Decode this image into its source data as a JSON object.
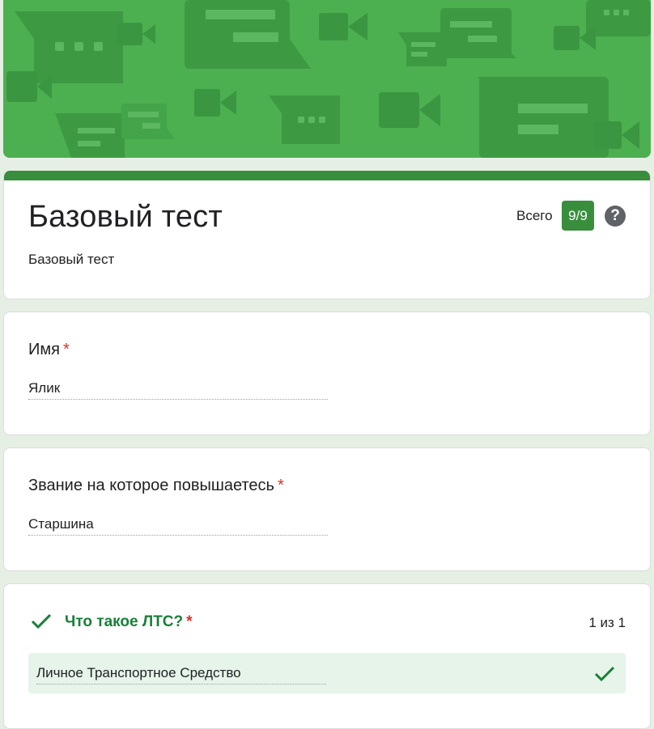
{
  "colors": {
    "accent": "#388e3c",
    "banner": "#4caf50",
    "correct": "#188038",
    "required": "#d93025",
    "correct_bg": "#e6f4ea"
  },
  "header": {
    "title": "Базовый тест",
    "description": "Базовый тест",
    "score_label": "Всего",
    "score_value": "9/9",
    "help_icon_glyph": "?"
  },
  "questions": [
    {
      "title": "Имя",
      "required_mark": "*",
      "answer": "Ялик"
    },
    {
      "title": "Звание на которое повышаетесь",
      "required_mark": "*",
      "answer": "Старшина"
    },
    {
      "title": "Что такое ЛТС?",
      "required_mark": "*",
      "points": "1 из 1",
      "answer": "Личное Транспортное Средство",
      "status_icon": "check-icon"
    }
  ]
}
